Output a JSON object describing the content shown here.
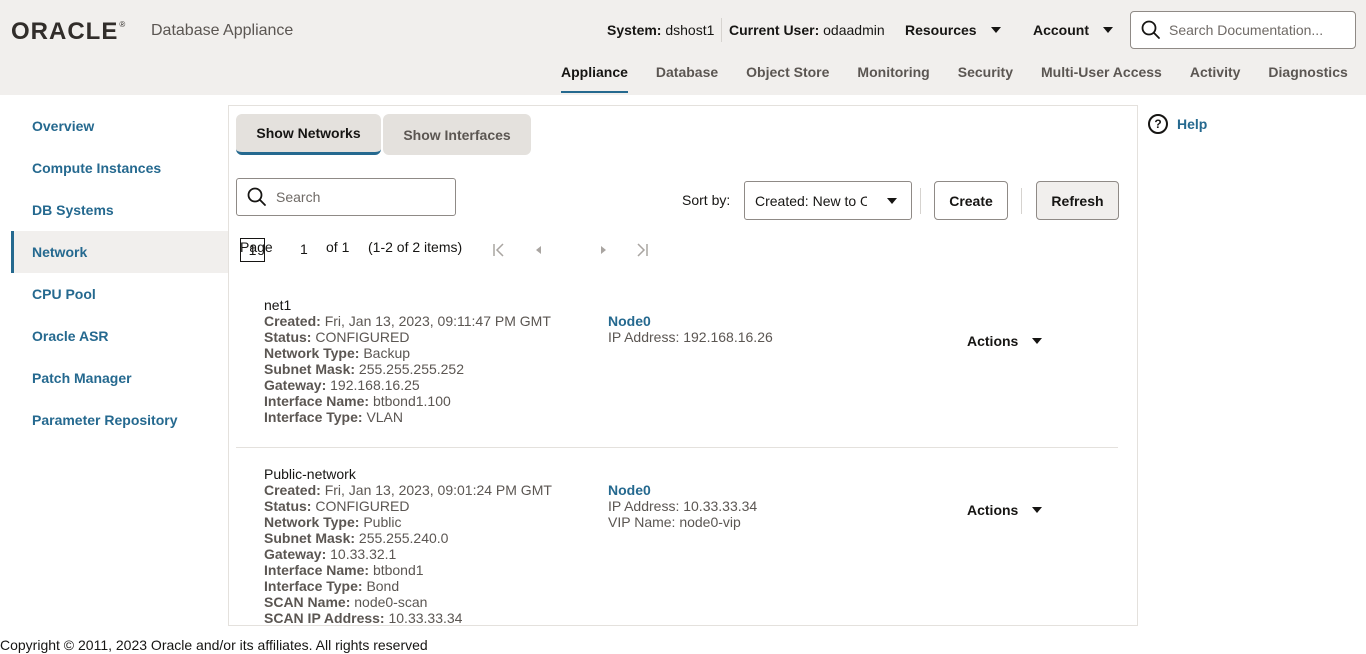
{
  "header": {
    "logo": "ORACLE",
    "app_name": "Database Appliance",
    "system_label": "System:",
    "system_value": "dshost1",
    "user_label": "Current User:",
    "user_value": "odaadmin",
    "resources_label": "Resources",
    "account_label": "Account",
    "search_placeholder": "Search Documentation..."
  },
  "nav": {
    "items": [
      "Appliance",
      "Database",
      "Object Store",
      "Monitoring",
      "Security",
      "Multi-User Access",
      "Activity",
      "Diagnostics"
    ],
    "active": "Appliance"
  },
  "sidebar": {
    "items": [
      "Overview",
      "Compute Instances",
      "DB Systems",
      "Network",
      "CPU Pool",
      "Oracle ASR",
      "Patch Manager",
      "Parameter Repository"
    ],
    "active": "Network"
  },
  "toolbar": {
    "tab_networks": "Show Networks",
    "tab_interfaces": "Show Interfaces",
    "search_placeholder": "Search",
    "sort_label": "Sort by:",
    "sort_value": "Created: New to Old",
    "create_label": "Create",
    "refresh_label": "Refresh"
  },
  "pager": {
    "page_label": "Page",
    "page_number": "1",
    "of_label": "of 1",
    "items_label": "(1-2 of 2 items)",
    "current": "1"
  },
  "networks": [
    {
      "name": "net1",
      "fields": [
        {
          "label": "Created:",
          "value": "Fri, Jan 13, 2023, 09:11:47 PM GMT"
        },
        {
          "label": "Status:",
          "value": "CONFIGURED"
        },
        {
          "label": "Network Type:",
          "value": "Backup"
        },
        {
          "label": "Subnet Mask:",
          "value": "255.255.255.252"
        },
        {
          "label": "Gateway:",
          "value": "192.168.16.25"
        },
        {
          "label": "Interface Name:",
          "value": "btbond1.100"
        },
        {
          "label": "Interface Type:",
          "value": "VLAN"
        }
      ],
      "node": "Node0",
      "node_details": [
        "IP Address: 192.168.16.26"
      ],
      "actions_label": "Actions"
    },
    {
      "name": "Public-network",
      "fields": [
        {
          "label": "Created:",
          "value": "Fri, Jan 13, 2023, 09:01:24 PM GMT"
        },
        {
          "label": "Status:",
          "value": "CONFIGURED"
        },
        {
          "label": "Network Type:",
          "value": "Public"
        },
        {
          "label": "Subnet Mask:",
          "value": "255.255.240.0"
        },
        {
          "label": "Gateway:",
          "value": "10.33.32.1"
        },
        {
          "label": "Interface Name:",
          "value": "btbond1"
        },
        {
          "label": "Interface Type:",
          "value": "Bond"
        },
        {
          "label": "SCAN Name:",
          "value": "node0-scan"
        },
        {
          "label": "SCAN IP Address:",
          "value": "10.33.33.34"
        }
      ],
      "node": "Node0",
      "node_details": [
        "IP Address: 10.33.33.34",
        "VIP Name: node0-vip"
      ],
      "actions_label": "Actions"
    }
  ],
  "help_label": "Help",
  "footer": "Copyright © 2011, 2023 Oracle and/or its affiliates. All rights reserved",
  "colors": {
    "accent": "#25698f",
    "header_bg": "#f1efed",
    "text": "#161513",
    "muted": "#5b5652"
  }
}
